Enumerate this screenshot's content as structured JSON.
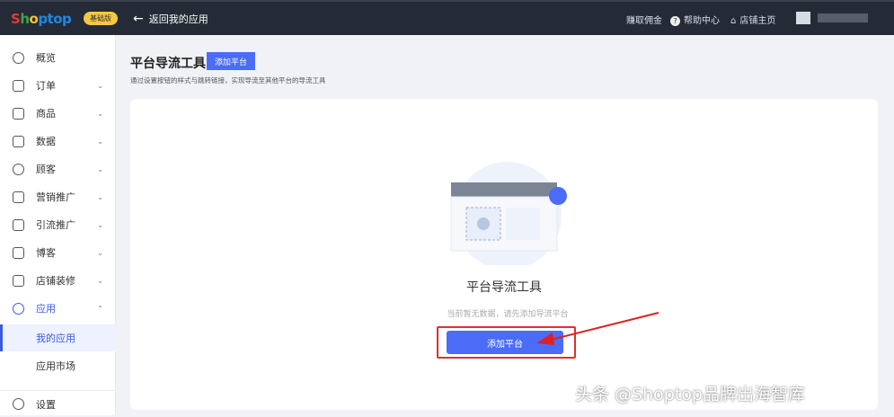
{
  "header": {
    "logo": "Shoptop",
    "plan_badge": "基础版",
    "back_label": "返回我的应用",
    "earn": "赚取佣金",
    "help": "帮助中心",
    "store": "店铺主页"
  },
  "sidebar": {
    "items": [
      {
        "label": "概览"
      },
      {
        "label": "订单"
      },
      {
        "label": "商品"
      },
      {
        "label": "数据"
      },
      {
        "label": "顾客"
      },
      {
        "label": "营销推广"
      },
      {
        "label": "引流推广"
      },
      {
        "label": "博客"
      },
      {
        "label": "店铺装修"
      },
      {
        "label": "应用"
      }
    ],
    "sub": [
      {
        "label": "我的应用"
      },
      {
        "label": "应用市场"
      }
    ],
    "settings": "设置"
  },
  "page": {
    "title": "平台导流工具",
    "add_button": "添加平台",
    "description": "通过设置按钮的样式与跳转链接，实现导流至其他平台的导流工具"
  },
  "empty": {
    "title": "平台导流工具",
    "message": "当前暂无数据，请先添加导流平台",
    "button": "添加平台"
  },
  "watermark": "头条 @Shoptop品牌出海智库"
}
